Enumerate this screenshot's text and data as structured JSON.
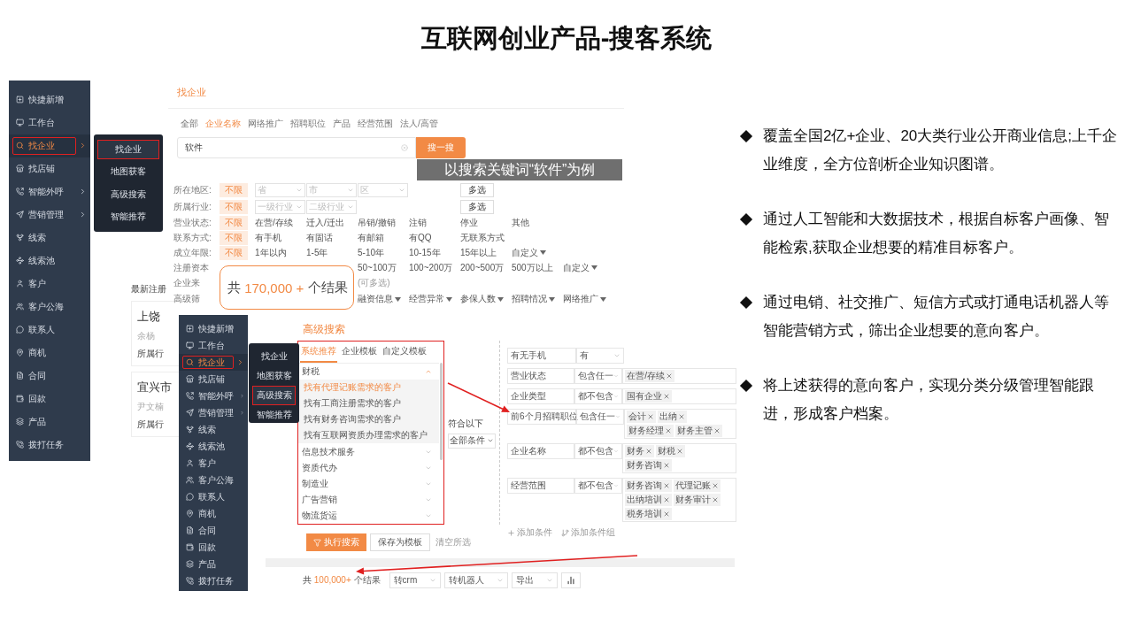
{
  "slide_title": "互联网创业产品-搜客系统",
  "sidebar": {
    "items": [
      {
        "label": "快捷新增",
        "selected": false,
        "submenu": false
      },
      {
        "label": "工作台",
        "selected": false,
        "submenu": false
      },
      {
        "label": "找企业",
        "selected": true,
        "submenu": true
      },
      {
        "label": "找店铺",
        "selected": false,
        "submenu": false
      },
      {
        "label": "智能外呼",
        "selected": false,
        "submenu": true
      },
      {
        "label": "营销管理",
        "selected": false,
        "submenu": true
      },
      {
        "label": "线索",
        "selected": false,
        "submenu": false
      },
      {
        "label": "线索池",
        "selected": false,
        "submenu": false
      },
      {
        "label": "客户",
        "selected": false,
        "submenu": false
      },
      {
        "label": "客户公海",
        "selected": false,
        "submenu": false
      },
      {
        "label": "联系人",
        "selected": false,
        "submenu": false
      },
      {
        "label": "商机",
        "selected": false,
        "submenu": false
      },
      {
        "label": "合同",
        "selected": false,
        "submenu": false
      },
      {
        "label": "回款",
        "selected": false,
        "submenu": false
      },
      {
        "label": "产品",
        "selected": false,
        "submenu": false
      },
      {
        "label": "拨打任务",
        "selected": false,
        "submenu": false
      }
    ]
  },
  "submenu": {
    "items": [
      {
        "label": "找企业",
        "selected": true
      },
      {
        "label": "地图获客",
        "selected": false
      },
      {
        "label": "高级搜索",
        "selected": false
      },
      {
        "label": "智能推荐",
        "selected": false
      }
    ]
  },
  "sidebar2": {
    "items": [
      {
        "label": "快捷新增",
        "selected": false,
        "submenu": false
      },
      {
        "label": "工作台",
        "selected": false,
        "submenu": false
      },
      {
        "label": "找企业",
        "selected": true,
        "submenu": true
      },
      {
        "label": "找店铺",
        "selected": false,
        "submenu": false
      },
      {
        "label": "智能外呼",
        "selected": false,
        "submenu": true
      },
      {
        "label": "营销管理",
        "selected": false,
        "submenu": true
      },
      {
        "label": "线索",
        "selected": false,
        "submenu": false
      },
      {
        "label": "线索池",
        "selected": false,
        "submenu": false
      },
      {
        "label": "客户",
        "selected": false,
        "submenu": false
      },
      {
        "label": "客户公海",
        "selected": false,
        "submenu": false
      },
      {
        "label": "联系人",
        "selected": false,
        "submenu": false
      },
      {
        "label": "商机",
        "selected": false,
        "submenu": false
      },
      {
        "label": "合同",
        "selected": false,
        "submenu": false
      },
      {
        "label": "回款",
        "selected": false,
        "submenu": false
      },
      {
        "label": "产品",
        "selected": false,
        "submenu": false
      },
      {
        "label": "拨打任务",
        "selected": false,
        "submenu": false
      }
    ]
  },
  "submenu2": {
    "items": [
      {
        "label": "找企业",
        "selected": false
      },
      {
        "label": "地图获客",
        "selected": false
      },
      {
        "label": "高级搜索",
        "selected": true
      },
      {
        "label": "智能推荐",
        "selected": false
      }
    ]
  },
  "find_page": {
    "title": "找企业",
    "tabs": [
      {
        "label": "全部",
        "selected": false
      },
      {
        "label": "企业名称",
        "selected": true
      },
      {
        "label": "网络推广",
        "selected": false
      },
      {
        "label": "招聘职位",
        "selected": false
      },
      {
        "label": "产品",
        "selected": false
      },
      {
        "label": "经营范围",
        "selected": false
      },
      {
        "label": "法人/高管",
        "selected": false
      }
    ],
    "search": {
      "value": "软件",
      "button": "搜一搜"
    },
    "filters": [
      {
        "kind": "full",
        "label": "所在地区:",
        "items": [
          {
            "kind": "option",
            "text": "不限",
            "selected": true
          },
          {
            "kind": "select",
            "placeholder": "省"
          },
          {
            "kind": "select",
            "placeholder": "市"
          },
          {
            "kind": "select",
            "placeholder": "区"
          },
          {
            "kind": "button",
            "text": "多选"
          }
        ]
      },
      {
        "kind": "full",
        "label": "所属行业:",
        "items": [
          {
            "kind": "option",
            "text": "不限",
            "selected": true
          },
          {
            "kind": "select",
            "placeholder": "一级行业"
          },
          {
            "kind": "select",
            "placeholder": "二级行业"
          },
          {
            "kind": "button",
            "text": "多选"
          }
        ]
      },
      {
        "kind": "full",
        "label": "营业状态:",
        "items": [
          {
            "kind": "option",
            "text": "不限",
            "selected": true
          },
          {
            "kind": "option",
            "text": "在营/存续",
            "selected": false
          },
          {
            "kind": "option",
            "text": "迁入/迁出",
            "selected": false
          },
          {
            "kind": "option",
            "text": "吊销/撤销",
            "selected": false
          },
          {
            "kind": "option",
            "text": "注销",
            "selected": false
          },
          {
            "kind": "option",
            "text": "停业",
            "selected": false
          },
          {
            "kind": "option",
            "text": "其他",
            "selected": false
          }
        ]
      },
      {
        "kind": "full",
        "label": "联系方式:",
        "items": [
          {
            "kind": "option",
            "text": "不限",
            "selected": true
          },
          {
            "kind": "option",
            "text": "有手机",
            "selected": false
          },
          {
            "kind": "option",
            "text": "有固话",
            "selected": false
          },
          {
            "kind": "option",
            "text": "有邮箱",
            "selected": false
          },
          {
            "kind": "option",
            "text": "有QQ",
            "selected": false
          },
          {
            "kind": "option",
            "text": "无联系方式",
            "selected": false
          }
        ]
      },
      {
        "kind": "full",
        "label": "成立年限:",
        "items": [
          {
            "kind": "option",
            "text": "不限",
            "selected": true
          },
          {
            "kind": "option",
            "text": "1年以内",
            "selected": false
          },
          {
            "kind": "option",
            "text": "1-5年",
            "selected": false
          },
          {
            "kind": "option",
            "text": "5-10年",
            "selected": false
          },
          {
            "kind": "option",
            "text": "10-15年",
            "selected": false
          },
          {
            "kind": "option",
            "text": "15年以上",
            "selected": false
          },
          {
            "kind": "dropdown",
            "text": "自定义"
          }
        ]
      },
      {
        "kind": "covered",
        "label": "注册资本",
        "items": [
          {
            "kind": "option",
            "text": "50~100万",
            "selected": false
          },
          {
            "kind": "option",
            "text": "100~200万",
            "selected": false
          },
          {
            "kind": "option",
            "text": "200~500万",
            "selected": false
          },
          {
            "kind": "option",
            "text": "500万以上",
            "selected": false
          },
          {
            "kind": "dropdown",
            "text": "自定义"
          }
        ]
      },
      {
        "kind": "covered",
        "label": "企业来",
        "items": [
          {
            "kind": "hint",
            "text": "(可多选)"
          }
        ]
      },
      {
        "kind": "covered",
        "label": "高级筛",
        "items": [
          {
            "kind": "dropdown",
            "text": "融资信息"
          },
          {
            "kind": "dropdown",
            "text": "经营异常"
          },
          {
            "kind": "dropdown",
            "text": "参保人数"
          },
          {
            "kind": "dropdown",
            "text": "招聘情况"
          },
          {
            "kind": "dropdown",
            "text": "网络推广"
          }
        ]
      }
    ]
  },
  "latest": {
    "title": "最新注册",
    "cards": [
      {
        "name": "上饶",
        "person": "余杨",
        "industry": "所属行"
      },
      {
        "name": "宜兴市",
        "person": "尹文楠",
        "industry": "所属行"
      }
    ]
  },
  "caption": "以搜索关键词“软件”为例",
  "callout": {
    "prefix": "共",
    "count": "170,000 +",
    "suffix": "个结果"
  },
  "advanced": {
    "title": "高级搜索",
    "template_tabs": [
      {
        "label": "系统推荐",
        "selected": true
      },
      {
        "label": "企业模板",
        "selected": false
      },
      {
        "label": "自定义模板",
        "selected": false
      }
    ],
    "categories": [
      {
        "label": "财税",
        "expanded": true,
        "children": [
          {
            "label": "找有代理记账需求的客户",
            "selected": true
          },
          {
            "label": "找有工商注册需求的客户",
            "selected": false
          },
          {
            "label": "找有财务咨询需求的客户",
            "selected": false
          },
          {
            "label": "找有互联网资质办理需求的客户",
            "selected": false
          }
        ]
      },
      {
        "label": "信息技术服务",
        "expanded": false
      },
      {
        "label": "资质代办",
        "expanded": false
      },
      {
        "label": "制造业",
        "expanded": false
      },
      {
        "label": "广告营销",
        "expanded": false
      },
      {
        "label": "物流货运",
        "expanded": false
      }
    ],
    "match": {
      "label": "符合以下",
      "value": "全部条件"
    },
    "conditions": [
      {
        "field": "有无手机",
        "operator": "有"
      },
      {
        "field": "营业状态",
        "operator": "包含任一",
        "values": [
          "在营/存续"
        ]
      },
      {
        "field": "企业类型",
        "operator": "都不包含",
        "values": [
          "国有企业"
        ]
      },
      {
        "field": "前6个月招聘职位",
        "operator": "包含任一",
        "values": [
          "会计",
          "出纳",
          "财务经理",
          "财务主管"
        ]
      },
      {
        "field": "企业名称",
        "operator": "都不包含",
        "values": [
          "财务",
          "财税",
          "财务咨询"
        ]
      },
      {
        "field": "经营范围",
        "operator": "都不包含",
        "values": [
          "财务咨询",
          "代理记账",
          "出纳培训",
          "财务审计",
          "税务培训"
        ]
      }
    ],
    "add_condition": "添加条件",
    "add_group": "添加条件组",
    "actions": [
      {
        "kind": "primary",
        "label": "执行搜索"
      },
      {
        "kind": "default",
        "label": "保存为模板"
      },
      {
        "kind": "link",
        "label": "清空所选"
      }
    ],
    "results": {
      "prefix": "共",
      "count": "100,000+",
      "suffix": "个结果",
      "selects": [
        "转crm",
        "转机器人",
        "导出"
      ]
    }
  },
  "points": [
    "覆盖全国2亿+企业、20大类行业公开商业信息;上千企业维度，全方位剖析企业知识图谱。",
    "通过人工智能和大数据技术，根据自标客户画像、智能检索,获取企业想要的精准目标客户。",
    "通过电销、社交推广、短信方式或打通电话机器人等智能营销方式，筛出企业想要的意向客户。",
    "将上述获得的意向客户，实现分类分级管理智能跟进，形成客户档案。"
  ]
}
